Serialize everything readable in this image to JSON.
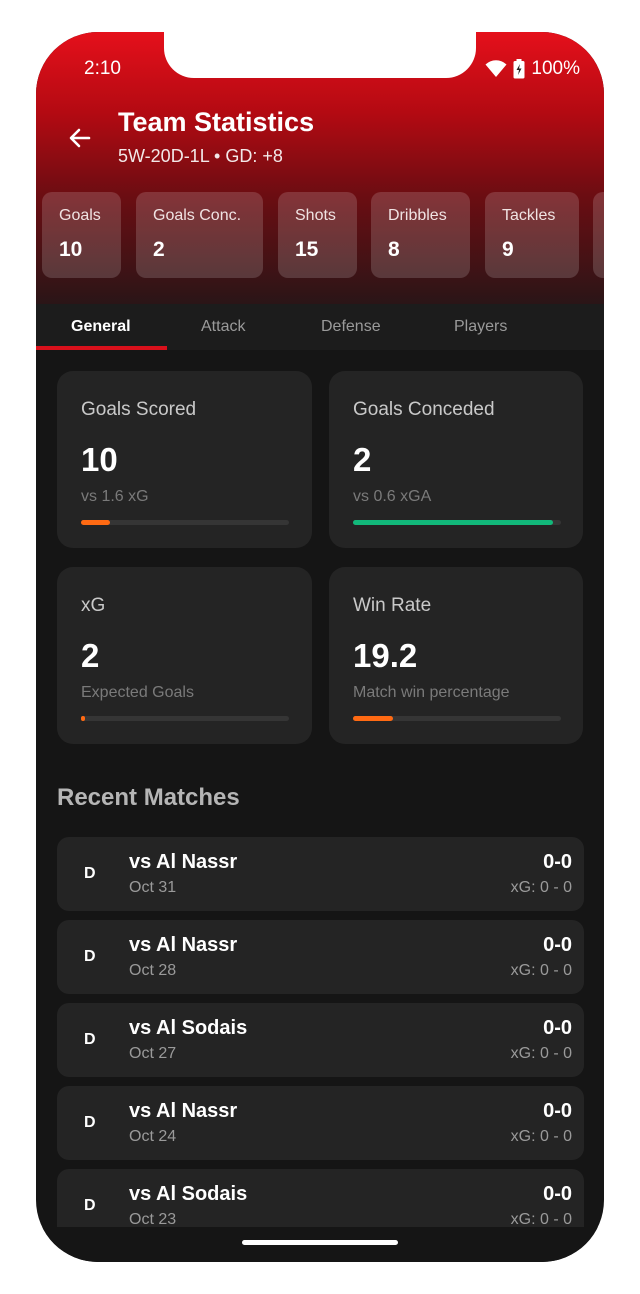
{
  "status_bar": {
    "time": "2:10",
    "battery": "100%"
  },
  "header": {
    "title": "Team Statistics",
    "subtitle": "5W-20D-1L • GD: +8",
    "back_icon": "arrow-back-icon"
  },
  "quick_stats": [
    {
      "label": "Goals",
      "value": "10"
    },
    {
      "label": "Goals Conc.",
      "value": "2"
    },
    {
      "label": "Shots",
      "value": "15"
    },
    {
      "label": "Dribbles",
      "value": "8"
    },
    {
      "label": "Tackles",
      "value": "9"
    }
  ],
  "tabs": [
    {
      "label": "General",
      "active": true
    },
    {
      "label": "Attack",
      "active": false
    },
    {
      "label": "Defense",
      "active": false
    },
    {
      "label": "Players",
      "active": false
    }
  ],
  "cards": [
    {
      "label": "Goals Scored",
      "value": "10",
      "sub": "vs 1.6 xG",
      "progress": 0.14,
      "color": "#ff6a13"
    },
    {
      "label": "Goals Conceded",
      "value": "2",
      "sub": "vs 0.6 xGA",
      "progress": 0.96,
      "color": "#12b87a"
    },
    {
      "label": "xG",
      "value": "2",
      "sub": "Expected Goals",
      "progress": 0.02,
      "color": "#ff6a13"
    },
    {
      "label": "Win Rate",
      "value": "19.2",
      "sub": "Match win percentage",
      "progress": 0.19,
      "color": "#ff6a13"
    }
  ],
  "recent_matches": {
    "title": "Recent Matches",
    "items": [
      {
        "result": "D",
        "opponent": "vs Al Nassr",
        "date": "Oct 31",
        "score": "0-0",
        "xg": "xG: 0 - 0"
      },
      {
        "result": "D",
        "opponent": "vs Al Nassr",
        "date": "Oct 28",
        "score": "0-0",
        "xg": "xG: 0 - 0"
      },
      {
        "result": "D",
        "opponent": "vs Al Sodais",
        "date": "Oct 27",
        "score": "0-0",
        "xg": "xG: 0 - 0"
      },
      {
        "result": "D",
        "opponent": "vs Al Nassr",
        "date": "Oct 24",
        "score": "0-0",
        "xg": "xG: 0 - 0"
      },
      {
        "result": "D",
        "opponent": "vs Al Sodais",
        "date": "Oct 23",
        "score": "0-0",
        "xg": "xG: 0 - 0"
      }
    ]
  }
}
